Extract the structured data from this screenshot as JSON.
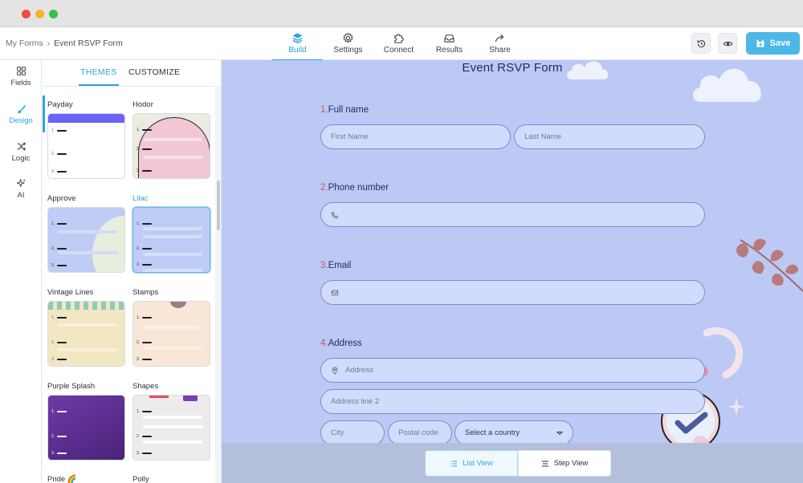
{
  "breadcrumb": {
    "root": "My Forms",
    "separator": "›",
    "current": "Event RSVP Form"
  },
  "nav_tabs": [
    {
      "label": "Build",
      "icon": "layers-icon",
      "active": true
    },
    {
      "label": "Settings",
      "icon": "gear-icon",
      "active": false
    },
    {
      "label": "Connect",
      "icon": "puzzle-icon",
      "active": false
    },
    {
      "label": "Results",
      "icon": "inbox-icon",
      "active": false
    },
    {
      "label": "Share",
      "icon": "share-arrow-icon",
      "active": false
    }
  ],
  "toolbar": {
    "history_icon": "history-icon",
    "preview_icon": "eye-icon",
    "save_label": "Save"
  },
  "rail": [
    {
      "label": "Fields",
      "icon": "grid-icon"
    },
    {
      "label": "Design",
      "icon": "brush-icon",
      "active": true
    },
    {
      "label": "Logic",
      "icon": "shuffle-icon"
    },
    {
      "label": "AI",
      "icon": "sparkle-icon"
    }
  ],
  "panel_tabs": {
    "themes": "THEMES",
    "customize": "CUSTOMIZE"
  },
  "themes": [
    {
      "name": "Payday"
    },
    {
      "name": "Hodor"
    },
    {
      "name": "Approve"
    },
    {
      "name": "Lilac",
      "selected": true
    },
    {
      "name": "Vintage Lines"
    },
    {
      "name": "Stamps"
    },
    {
      "name": "Purple Splash"
    },
    {
      "name": "Shapes"
    },
    {
      "name": "Pride 🌈"
    },
    {
      "name": "Polly"
    }
  ],
  "thumb_numbers": [
    "1.",
    "2.",
    "3."
  ],
  "form": {
    "title": "Event RSVP Form",
    "questions": [
      {
        "number": "1.",
        "label": "Full name",
        "first_placeholder": "First Name",
        "last_placeholder": "Last Name"
      },
      {
        "number": "2.",
        "label": "Phone number"
      },
      {
        "number": "3.",
        "label": "Email"
      },
      {
        "number": "4.",
        "label": "Address",
        "address_placeholder": "Address",
        "line2_placeholder": "Address line 2",
        "city_placeholder": "City",
        "postal_placeholder": "Postal code",
        "country_value": "Select a country"
      }
    ]
  },
  "view_toggle": {
    "list": "List View",
    "step": "Step View"
  },
  "colors": {
    "accent": "#2aa5da",
    "canvas": "#bcc9f5",
    "field": "#d1dbfb",
    "save": "#4cb8e6"
  }
}
